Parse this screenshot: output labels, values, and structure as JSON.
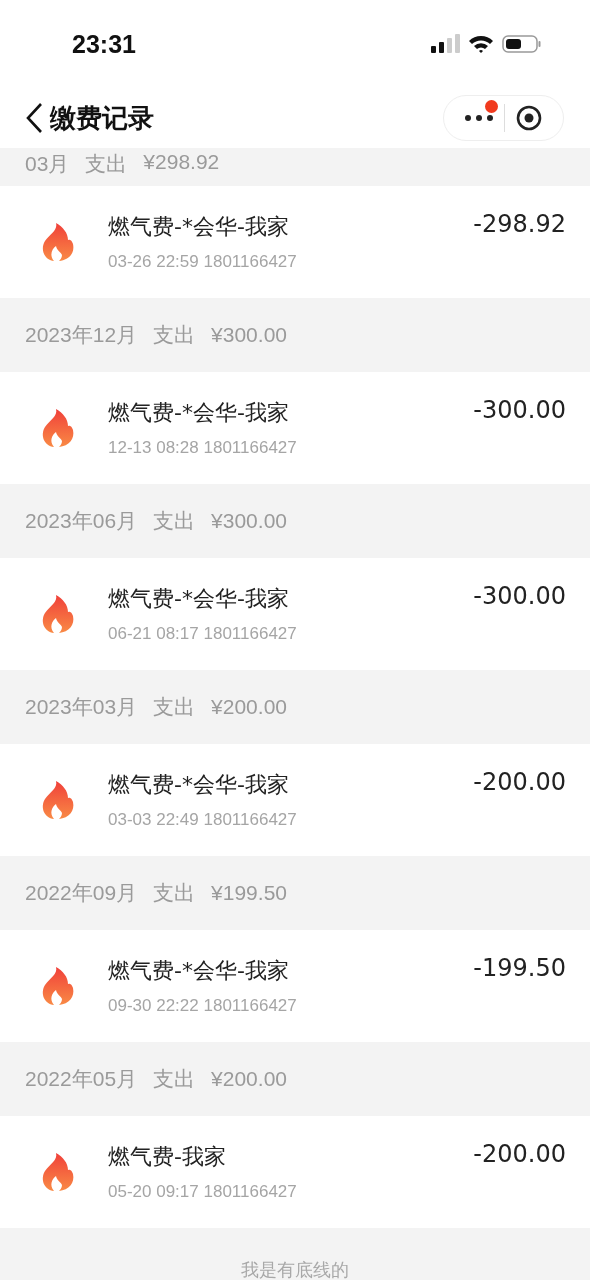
{
  "status_bar": {
    "time": "23:31"
  },
  "nav": {
    "title": "缴费记录",
    "menu_badge": true
  },
  "groups": [
    {
      "month": "03月",
      "label": "支出",
      "total": "¥298.92",
      "records": [
        {
          "title": "燃气费-*会华-我家",
          "meta": "03-26 22:59 1801166427",
          "amount": "-298.92"
        }
      ]
    },
    {
      "month": "2023年12月",
      "label": "支出",
      "total": "¥300.00",
      "records": [
        {
          "title": "燃气费-*会华-我家",
          "meta": "12-13 08:28 1801166427",
          "amount": "-300.00"
        }
      ]
    },
    {
      "month": "2023年06月",
      "label": "支出",
      "total": "¥300.00",
      "records": [
        {
          "title": "燃气费-*会华-我家",
          "meta": "06-21 08:17 1801166427",
          "amount": "-300.00"
        }
      ]
    },
    {
      "month": "2023年03月",
      "label": "支出",
      "total": "¥200.00",
      "records": [
        {
          "title": "燃气费-*会华-我家",
          "meta": "03-03 22:49 1801166427",
          "amount": "-200.00"
        }
      ]
    },
    {
      "month": "2022年09月",
      "label": "支出",
      "total": "¥199.50",
      "records": [
        {
          "title": "燃气费-*会华-我家",
          "meta": "09-30 22:22 1801166427",
          "amount": "-199.50"
        }
      ]
    },
    {
      "month": "2022年05月",
      "label": "支出",
      "total": "¥200.00",
      "records": [
        {
          "title": "燃气费-我家",
          "meta": "05-20 09:17 1801166427",
          "amount": "-200.00"
        }
      ]
    }
  ],
  "footer": "我是有底线的"
}
